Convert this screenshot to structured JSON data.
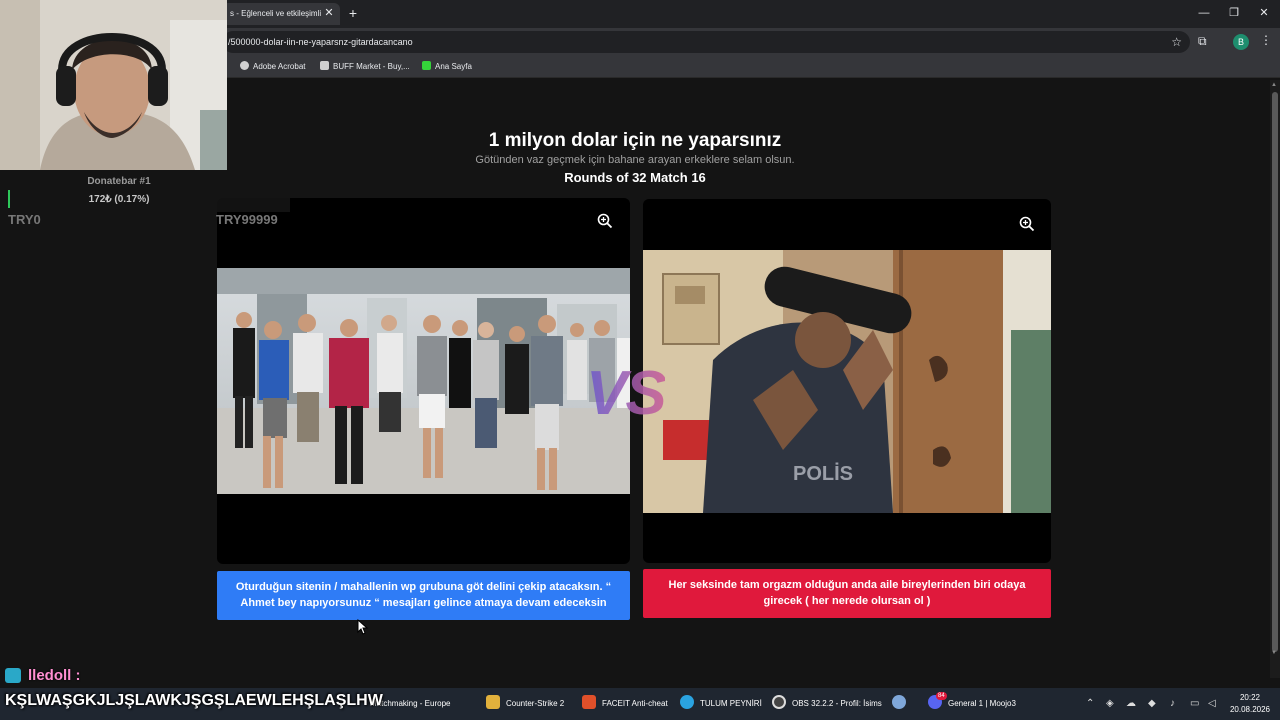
{
  "browser": {
    "tab_title": "s - Eğlenceli ve etkileşimli",
    "url": "/500000-dolar-iin-ne-yaparsnz-gitardacancano",
    "profile_initial": "B",
    "bookmarks": [
      {
        "label": "Adobe Acrobat",
        "color": "#d0d0d0"
      },
      {
        "label": "BUFF Market - Buy,...",
        "color": "#d0d0d0"
      },
      {
        "label": "Ana Sayfa",
        "color": "#35d43a"
      }
    ]
  },
  "page": {
    "title": "1 milyon dolar için ne yaparsınız",
    "subtitle": "Götünden vaz geçmek için bahane arayan erkeklere selam olsun.",
    "rounds": "Rounds of 32 Match 16",
    "vs": "VS",
    "left_choice": "Oturduğun sitenin / mahallenin wp grubuna göt delini çekip atacaksın. “ Ahmet bey napıyorsunuz “ mesajları gelince atmaya devam edeceksin",
    "right_choice": "Her seksinde tam orgazm olduğun anda aile bireylerinden biri odaya girecek ( her nerede olursan ol )",
    "left_color": "#2f7cf6",
    "right_color": "#e0193c"
  },
  "overlay": {
    "donate_title": "Donatebar #1",
    "donate_amount": "172₺ (0.17%)",
    "donate_progress": 0.0017,
    "donate_min": "TRY0",
    "donate_max": "TRY99999",
    "chat_user": "lledoll :",
    "chat_message": "KŞLWAŞGKJLJŞLAWKJŞGŞLAEWLEHŞLAŞLHW"
  },
  "taskbar": {
    "items": [
      {
        "label": "Matchmaking - Europe",
        "color": "#3a6bd0"
      },
      {
        "label": "Counter-Strike 2",
        "color": "#e2b13c"
      },
      {
        "label": "FACEIT Anti-cheat",
        "color": "#e0502a"
      },
      {
        "label": "TULUM PEYNİRİ",
        "color": "#2aa3e0"
      },
      {
        "label": "OBS 32.2.2 - Profil: İsims",
        "color": "#444"
      },
      {
        "label": "General 1 | Moojo3",
        "color": "#5865f2"
      }
    ],
    "discord_badge": "84",
    "time": "20:22",
    "date": "20.08.2026"
  }
}
